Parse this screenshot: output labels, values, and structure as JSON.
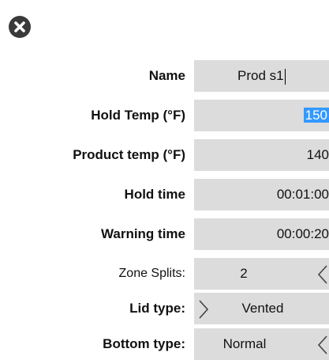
{
  "dialog": {
    "close_icon": "close-circle-icon"
  },
  "form": {
    "name": {
      "label": "Name",
      "value": "Prod s1"
    },
    "hold_temp": {
      "label": "Hold Temp (°F)",
      "value": "150"
    },
    "product_temp": {
      "label": "Product temp (°F)",
      "value": "140"
    },
    "hold_time": {
      "label": "Hold time",
      "value": "00:01:00"
    },
    "warning_time": {
      "label": "Warning time",
      "value": "00:00:20"
    },
    "zone_splits": {
      "label": "Zone Splits:",
      "value": "2"
    },
    "lid_type": {
      "label": "Lid type:",
      "value": "Vented"
    },
    "bottom_type": {
      "label": "Bottom type:",
      "value": "Normal"
    }
  },
  "colors": {
    "field_bg": "#dcdcdc",
    "selection": "#3399ff",
    "icon_dark": "#3a3a3a"
  }
}
